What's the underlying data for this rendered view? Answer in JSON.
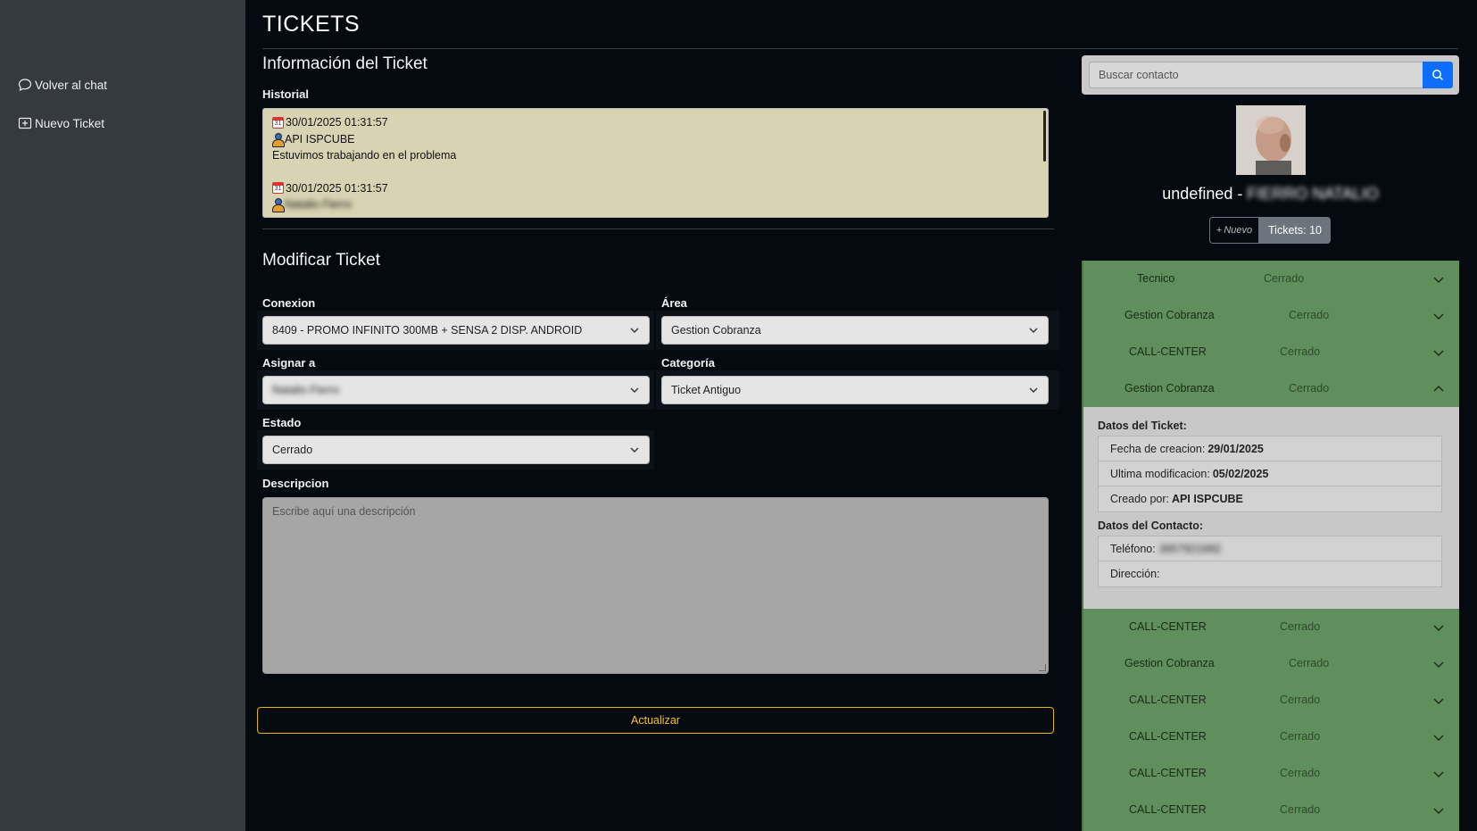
{
  "sidebar": {
    "items": [
      {
        "label": "Volver al chat",
        "icon": "chat-bubble-icon"
      },
      {
        "label": "Nuevo Ticket",
        "icon": "new-ticket-icon"
      }
    ]
  },
  "header": {
    "title": "TICKETS"
  },
  "info": {
    "title": "Información del Ticket",
    "historial_label": "Historial",
    "historial": [
      {
        "date": "30/01/2025 01:31:57",
        "user": "API ISPCUBE",
        "text": "Estuvimos trabajando en el problema"
      },
      {
        "date": "30/01/2025 01:31:57",
        "user": "Natalio Fierro",
        "text": ""
      }
    ]
  },
  "form": {
    "title": "Modificar Ticket",
    "conexion_label": "Conexion",
    "conexion_value": "8409 - PROMO INFINITO 300MB + SENSA 2 DISP. ANDROID",
    "area_label": "Área",
    "area_value": "Gestion Cobranza",
    "asignar_label": "Asignar a",
    "asignar_value": "Natalio Fierro",
    "categoria_label": "Categoría",
    "categoria_value": "Ticket Antiguo",
    "estado_label": "Estado",
    "estado_value": "Cerrado",
    "descripcion_label": "Descripcion",
    "descripcion_placeholder": "Escribe aquí una descripción",
    "update_label": "Actualizar"
  },
  "contact": {
    "search_placeholder": "Buscar contacto",
    "name_prefix": "undefined - ",
    "name": "FIERRO NATALIO",
    "nuevo_label": "Nuevo",
    "tickets_label": "Tickets: 10"
  },
  "tickets": [
    {
      "area": "Tecnico",
      "state": "Cerrado",
      "expanded": false
    },
    {
      "area": "Gestion Cobranza",
      "state": "Cerrado",
      "expanded": false
    },
    {
      "area": "CALL-CENTER",
      "state": "Cerrado",
      "expanded": false
    },
    {
      "area": "Gestion Cobranza",
      "state": "Cerrado",
      "expanded": true
    },
    {
      "area": "CALL-CENTER",
      "state": "Cerrado",
      "expanded": false
    },
    {
      "area": "Gestion Cobranza",
      "state": "Cerrado",
      "expanded": false
    },
    {
      "area": "CALL-CENTER",
      "state": "Cerrado",
      "expanded": false
    },
    {
      "area": "CALL-CENTER",
      "state": "Cerrado",
      "expanded": false
    },
    {
      "area": "CALL-CENTER",
      "state": "Cerrado",
      "expanded": false
    },
    {
      "area": "CALL-CENTER",
      "state": "Cerrado",
      "expanded": false
    }
  ],
  "ticket_details": {
    "datos_ticket_title": "Datos del Ticket:",
    "fecha_label": "Fecha de creacion:",
    "fecha_value": "29/01/2025",
    "ultima_label": "Ultima modificacion:",
    "ultima_value": "05/02/2025",
    "creado_label": "Creado por:",
    "creado_value": "API ISPCUBE",
    "datos_contacto_title": "Datos del Contacto:",
    "telefono_label": "Teléfono:",
    "telefono_value": "3957921682",
    "direccion_label": "Dirección:"
  },
  "colors": {
    "sidebar": "#343a40",
    "background": "#050a10",
    "accent_yellow": "#f5c518",
    "primary_blue": "#0d6efd",
    "ticket_green": "#5e8f5c"
  }
}
